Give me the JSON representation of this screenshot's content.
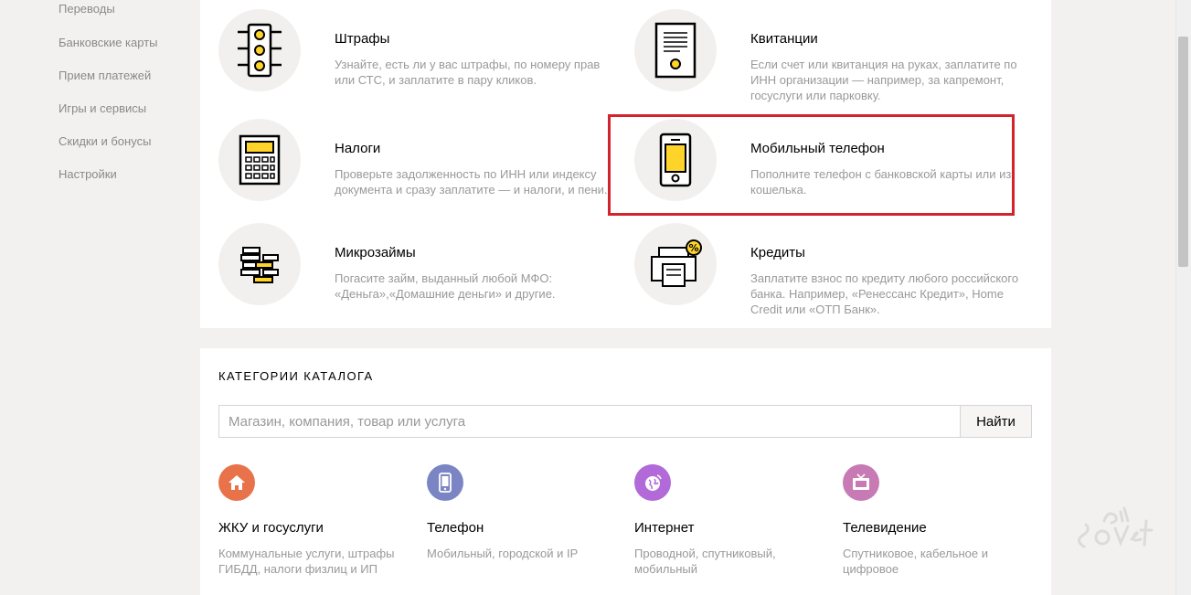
{
  "sidebar": {
    "items": [
      {
        "label": "Переводы"
      },
      {
        "label": "Банковские карты"
      },
      {
        "label": "Прием платежей"
      },
      {
        "label": "Игры и сервисы"
      },
      {
        "label": "Скидки и бонусы"
      },
      {
        "label": "Настройки"
      }
    ]
  },
  "services": [
    {
      "title": "Штрафы",
      "desc": "Узнайте, есть ли у вас штрафы, по номеру прав или СТС, и заплатите в пару кликов.",
      "icon": "traffic-light-icon"
    },
    {
      "title": "Квитанции",
      "desc": "Если счет или квитанция на руках, заплатите по ИНН организации — например, за капремонт, госуслуги или парковку.",
      "icon": "receipt-icon"
    },
    {
      "title": "Налоги",
      "desc": "Проверьте задолженность по ИНН или индексу документа и сразу заплатите — и налоги, и пени.",
      "icon": "calculator-icon"
    },
    {
      "title": "Мобильный телефон",
      "desc": "Пополните телефон с банковской карты или из кошелька.",
      "icon": "mobile-phone-icon"
    },
    {
      "title": "Микрозаймы",
      "desc": "Погасите займ, выданный любой МФО: «Деньга»,«Домашние деньги» и другие.",
      "icon": "coins-stack-icon"
    },
    {
      "title": "Кредиты",
      "desc": "Заплатите взнос по кредиту любого российского банка. Например, «Ренессанс Кредит», Home Credit или «ОТП Банк».",
      "icon": "bank-percent-icon"
    }
  ],
  "catalog": {
    "heading": "КАТЕГОРИИ КАТАЛОГА",
    "search_placeholder": "Магазин, компания, товар или услуга",
    "search_button": "Найти",
    "categories": [
      {
        "title": "ЖКУ и госуслуги",
        "desc": "Коммунальные услуги, штрафы ГИБДД, налоги физлиц и ИП",
        "icon": "house-icon",
        "color": "#e8734a"
      },
      {
        "title": "Телефон",
        "desc": "Мобильный, городской и IP",
        "icon": "phone-icon",
        "color": "#7b85c4"
      },
      {
        "title": "Интернет",
        "desc": "Проводной, спутниковый, мобильный",
        "icon": "globe-icon",
        "color": "#b26ad8"
      },
      {
        "title": "Телевидение",
        "desc": "Спутниковое, кабельное и цифровое",
        "icon": "tv-icon",
        "color": "#c77ab4"
      }
    ]
  },
  "colors": {
    "highlight": "#d3232c",
    "accent_yellow": "#fed42b"
  }
}
